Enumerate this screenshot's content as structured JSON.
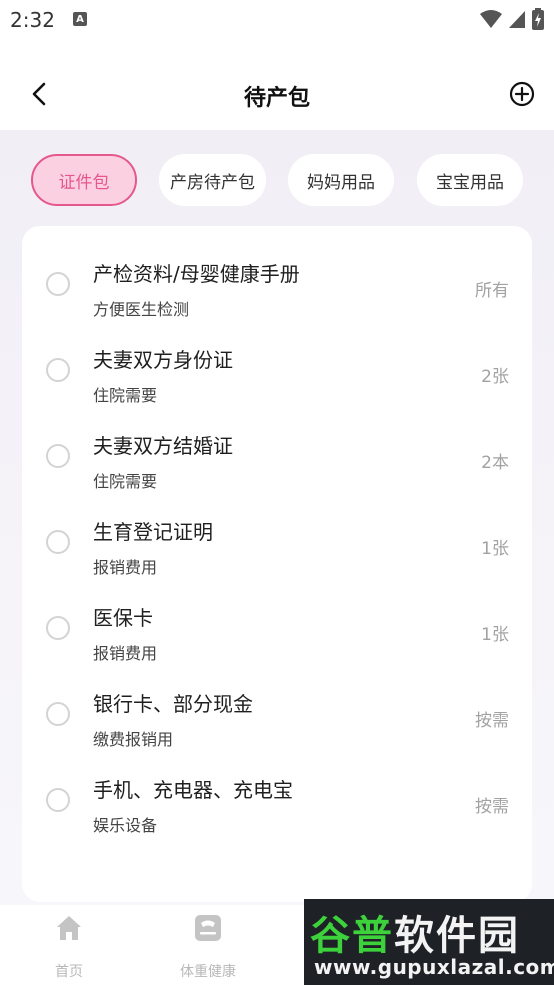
{
  "status_bar": {
    "time": "2:32",
    "notification_badge": "A"
  },
  "header": {
    "title": "待产包",
    "back_icon": "chevron-left-icon",
    "add_icon": "plus-circle-icon"
  },
  "tabs": [
    {
      "label": "证件包",
      "active": true
    },
    {
      "label": "产房待产包",
      "active": false
    },
    {
      "label": "妈妈用品",
      "active": false
    },
    {
      "label": "宝宝用品",
      "active": false
    }
  ],
  "items": [
    {
      "title": "产检资料/母婴健康手册",
      "subtitle": "方便医生检测",
      "quantity": "所有"
    },
    {
      "title": "夫妻双方身份证",
      "subtitle": "住院需要",
      "quantity": "2张"
    },
    {
      "title": "夫妻双方结婚证",
      "subtitle": "住院需要",
      "quantity": "2本"
    },
    {
      "title": "生育登记证明",
      "subtitle": "报销费用",
      "quantity": "1张"
    },
    {
      "title": "医保卡",
      "subtitle": "报销费用",
      "quantity": "1张"
    },
    {
      "title": "银行卡、部分现金",
      "subtitle": "缴费报销用",
      "quantity": "按需"
    },
    {
      "title": "手机、充电器、充电宝",
      "subtitle": "娱乐设备",
      "quantity": "按需"
    }
  ],
  "bottom_nav": [
    {
      "label": "首页",
      "icon": "home-icon"
    },
    {
      "label": "体重健康",
      "icon": "scale-icon"
    }
  ],
  "watermark": {
    "title_part1": "谷普",
    "title_part2": "软件园",
    "url": "www.gupuxlazal.com"
  },
  "colors": {
    "accent": "#e5578d",
    "accent_bg": "#fbd1e1",
    "muted": "#a2a2a2"
  }
}
